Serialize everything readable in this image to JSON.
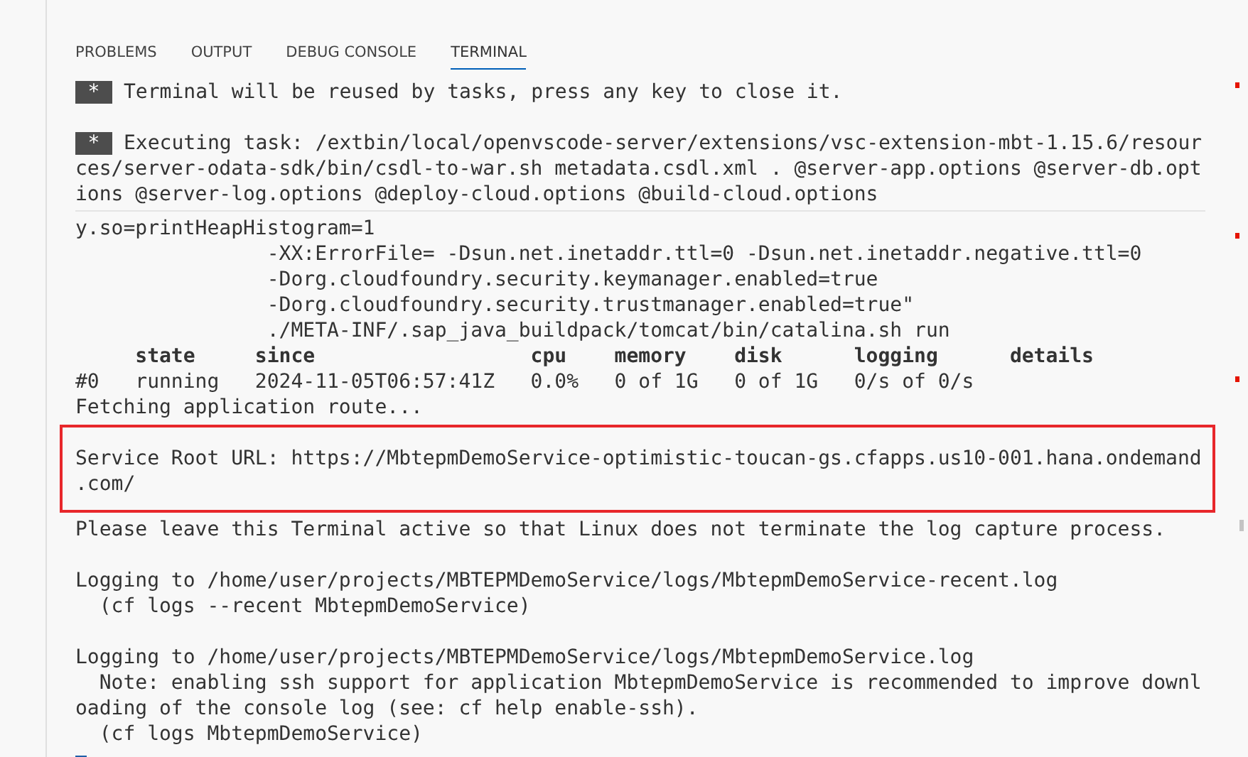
{
  "tabs": [
    {
      "label": "PROBLEMS",
      "selected": false
    },
    {
      "label": "OUTPUT",
      "selected": false
    },
    {
      "label": "DEBUG CONSOLE",
      "selected": false
    },
    {
      "label": "TERMINAL",
      "selected": true
    }
  ],
  "terminal": {
    "sticky_lines": [
      {
        "kind": "badge",
        "badge": "*",
        "text": "Terminal will be reused by tasks, press any key to close it."
      },
      {
        "kind": "blank"
      },
      {
        "kind": "badge",
        "badge": "*",
        "text": "Executing task: /extbin/local/openvscode-server/extensions/vsc-extension-mbt-1.15.6/resour"
      },
      {
        "kind": "text",
        "text": "ces/server-odata-sdk/bin/csdl-to-war.sh metadata.csdl.xml . @server-app.options @server-db.opt"
      },
      {
        "kind": "text",
        "text": "ions @server-log.options @deploy-cloud.options @build-cloud.options"
      }
    ],
    "lines": [
      {
        "kind": "text",
        "text": "y.so=printHeapHistogram=1"
      },
      {
        "kind": "text",
        "text": "                -XX:ErrorFile= -Dsun.net.inetaddr.ttl=0 -Dsun.net.inetaddr.negative.ttl=0"
      },
      {
        "kind": "text",
        "text": "                -Dorg.cloudfoundry.security.keymanager.enabled=true"
      },
      {
        "kind": "text",
        "text": "                -Dorg.cloudfoundry.security.trustmanager.enabled=true\""
      },
      {
        "kind": "text",
        "text": "                ./META-INF/.sap_java_buildpack/tomcat/bin/catalina.sh run"
      },
      {
        "kind": "bold",
        "text": "     state     since                  cpu    memory    disk      logging      details"
      },
      {
        "kind": "text",
        "text": "#0   running   2024-11-05T06:57:41Z   0.0%   0 of 1G   0 of 1G   0/s of 0/s"
      },
      {
        "kind": "text",
        "text": "Fetching application route..."
      },
      {
        "kind": "highlight",
        "lines": [
          "Service Root URL: https://MbtepmDemoService-optimistic-toucan-gs.cfapps.us10-001.hana.ondemand",
          ".com/"
        ]
      },
      {
        "kind": "text",
        "text": "Please leave this Terminal active so that Linux does not terminate the log capture process."
      },
      {
        "kind": "blank"
      },
      {
        "kind": "text",
        "text": "Logging to /home/user/projects/MBTEPMDemoService/logs/MbtepmDemoService-recent.log"
      },
      {
        "kind": "text",
        "text": "  (cf logs --recent MbtepmDemoService)"
      },
      {
        "kind": "blank"
      },
      {
        "kind": "text",
        "text": "Logging to /home/user/projects/MBTEPMDemoService/logs/MbtepmDemoService.log"
      },
      {
        "kind": "text",
        "text": "  Note: enabling ssh support for application MbtepmDemoService is recommended to improve downl"
      },
      {
        "kind": "text",
        "text": "oading of the console log (see: cf help enable-ssh)."
      },
      {
        "kind": "text",
        "text": "  (cf logs MbtepmDemoService)"
      },
      {
        "kind": "cursor"
      }
    ]
  }
}
